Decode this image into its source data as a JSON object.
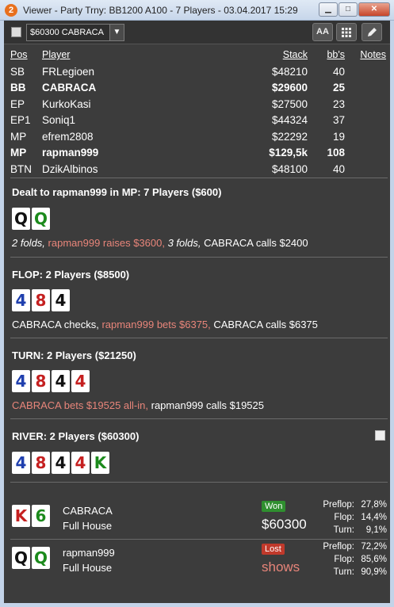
{
  "window": {
    "title": "Viewer - Party Trny: BB1200 A100 - 7 Players - 03.04.2017 15:29",
    "app_badge": "2"
  },
  "toolbar": {
    "hand_select": "$60300 CABRACA",
    "font_button": "AA",
    "grid_icon": "grid-icon",
    "edit_icon": "pencil-icon"
  },
  "players": {
    "headers": {
      "pos": "Pos",
      "player": "Player",
      "stack": "Stack",
      "bbs": "bb's",
      "notes": "Notes"
    },
    "rows": [
      {
        "pos": "SB",
        "name": "FRLegioen",
        "stack": "$48210",
        "bbs": "40",
        "bold": false
      },
      {
        "pos": "BB",
        "name": "CABRACA",
        "stack": "$29600",
        "bbs": "25",
        "bold": true
      },
      {
        "pos": "EP",
        "name": "KurkoKasi",
        "stack": "$27500",
        "bbs": "23",
        "bold": false
      },
      {
        "pos": "EP1",
        "name": "Soniq1",
        "stack": "$44324",
        "bbs": "37",
        "bold": false
      },
      {
        "pos": "MP",
        "name": "efrem2808",
        "stack": "$22292",
        "bbs": "19",
        "bold": false
      },
      {
        "pos": "MP",
        "name": "rapman999",
        "stack": "$129,5k",
        "bbs": "108",
        "bold": true
      },
      {
        "pos": "BTN",
        "name": "DzikAlbinos",
        "stack": "$48100",
        "bbs": "40",
        "bold": false
      }
    ]
  },
  "preflop": {
    "title": "Dealt to rapman999 in MP: 7 Players ($600)",
    "cards": [
      {
        "rank": "Q",
        "color": "black"
      },
      {
        "rank": "Q",
        "color": "green"
      }
    ],
    "actions": [
      {
        "text": "2 folds, ",
        "style": "it"
      },
      {
        "text": "rapman999 raises $3600, ",
        "style": "red"
      },
      {
        "text": "3 folds, ",
        "style": "it"
      },
      {
        "text": "CABRACA calls $2400",
        "style": ""
      }
    ]
  },
  "flop": {
    "title": "FLOP: 2 Players ($8500)",
    "cards": [
      {
        "rank": "4",
        "color": "blue"
      },
      {
        "rank": "8",
        "color": "red"
      },
      {
        "rank": "4",
        "color": "black"
      }
    ],
    "actions": [
      {
        "text": "CABRACA checks, ",
        "style": ""
      },
      {
        "text": "rapman999 bets $6375, ",
        "style": "red"
      },
      {
        "text": "CABRACA calls $6375",
        "style": ""
      }
    ]
  },
  "turn": {
    "title": "TURN: 2 Players ($21250)",
    "cards": [
      {
        "rank": "4",
        "color": "blue"
      },
      {
        "rank": "8",
        "color": "red"
      },
      {
        "rank": "4",
        "color": "black"
      },
      {
        "rank": "4",
        "color": "red"
      }
    ],
    "actions": [
      {
        "text": "CABRACA bets $19525 all-in, ",
        "style": "red"
      },
      {
        "text": "rapman999 calls $19525",
        "style": ""
      }
    ]
  },
  "river": {
    "title": "RIVER: 2 Players ($60300)",
    "cards": [
      {
        "rank": "4",
        "color": "blue"
      },
      {
        "rank": "8",
        "color": "red"
      },
      {
        "rank": "4",
        "color": "black"
      },
      {
        "rank": "4",
        "color": "red"
      },
      {
        "rank": "K",
        "color": "green"
      }
    ]
  },
  "results": [
    {
      "name": "CABRACA",
      "hand": "Full House",
      "cards": [
        {
          "rank": "K",
          "color": "red"
        },
        {
          "rank": "6",
          "color": "green"
        }
      ],
      "badge": "Won",
      "amount": "$60300",
      "equity": [
        {
          "label": "Preflop:",
          "value": "27,8%"
        },
        {
          "label": "Flop:",
          "value": "14,4%"
        },
        {
          "label": "Turn:",
          "value": "9,1%"
        }
      ]
    },
    {
      "name": "rapman999",
      "hand": "Full House",
      "cards": [
        {
          "rank": "Q",
          "color": "black"
        },
        {
          "rank": "Q",
          "color": "green"
        }
      ],
      "badge": "Lost",
      "amount": "shows",
      "equity": [
        {
          "label": "Preflop:",
          "value": "72,2%"
        },
        {
          "label": "Flop:",
          "value": "85,6%"
        },
        {
          "label": "Turn:",
          "value": "90,9%"
        }
      ]
    }
  ],
  "colors": {
    "background": "#3c3c3c",
    "red_text": "#e8857a",
    "won_badge": "#2f8f2f",
    "lost_badge": "#c0392b"
  }
}
